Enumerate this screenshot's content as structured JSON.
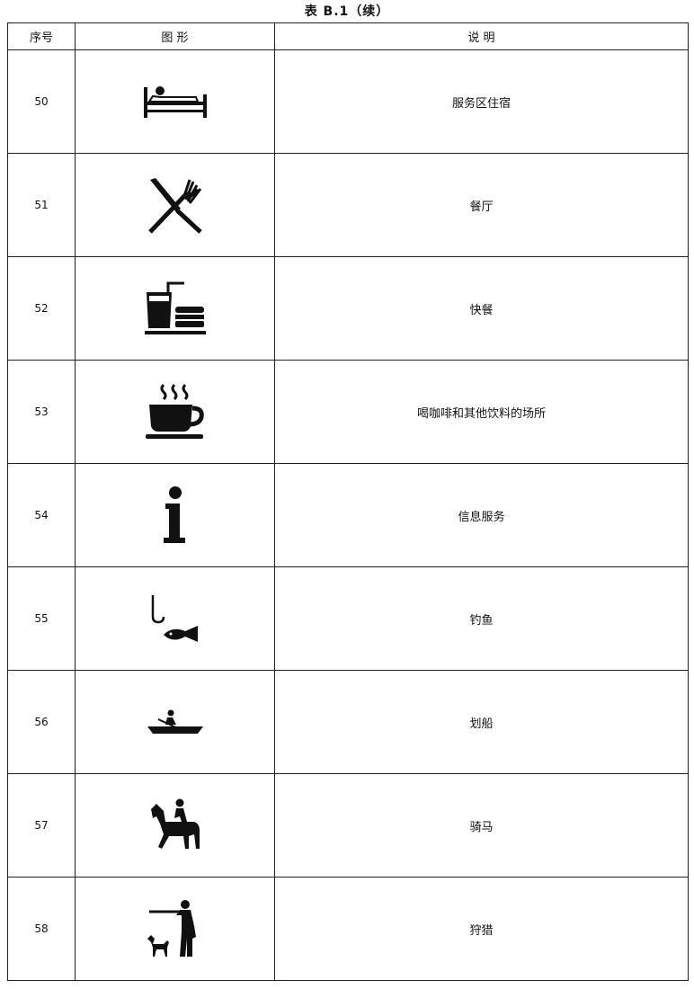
{
  "caption": "表 B.1（续）",
  "headers": {
    "num": "序号",
    "symbol": "图  形",
    "desc": "说    明"
  },
  "rows": [
    {
      "num": "50",
      "icon": "bed-icon",
      "desc": "服务区住宿"
    },
    {
      "num": "51",
      "icon": "knife-fork-icon",
      "desc": "餐厅"
    },
    {
      "num": "52",
      "icon": "fast-food-icon",
      "desc": "快餐"
    },
    {
      "num": "53",
      "icon": "coffee-cup-icon",
      "desc": "喝咖啡和其他饮料的场所"
    },
    {
      "num": "54",
      "icon": "information-icon",
      "desc": "信息服务"
    },
    {
      "num": "55",
      "icon": "fishing-icon",
      "desc": "钓鱼"
    },
    {
      "num": "56",
      "icon": "rowing-boat-icon",
      "desc": "划船"
    },
    {
      "num": "57",
      "icon": "horse-riding-icon",
      "desc": "骑马"
    },
    {
      "num": "58",
      "icon": "hunting-icon",
      "desc": "狩猎"
    }
  ]
}
